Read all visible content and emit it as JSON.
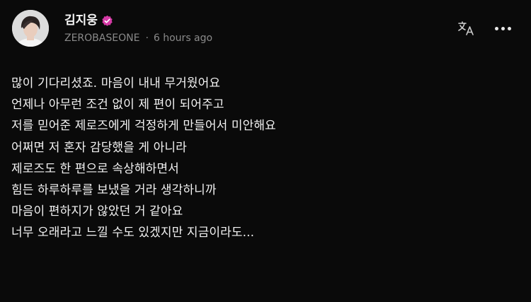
{
  "post": {
    "author_name": "김지웅",
    "group_name": "ZEROBASEONE",
    "separator": "·",
    "timestamp": "6 hours ago",
    "verified": true,
    "lines": [
      "많이 기다리셨죠. 마음이 내내 무거웠어요",
      "언제나 아무런 조건 없이 제 편이 되어주고",
      "저를 믿어준 제로즈에게 걱정하게 만들어서 미안해요",
      "어쩌면 저 혼자 감당했을 게 아니라",
      "제로즈도 한 편으로 속상해하면서",
      "힘든 하루하루를 보냈을 거라 생각하니까",
      "마음이 편하지가 않았던 거 같아요",
      "너무 오래라고 느낄 수도 있겠지만 지금이라도..."
    ]
  },
  "actions": {
    "translate_icon": "translate-icon",
    "more_icon": "more-horizontal-icon"
  },
  "colors": {
    "background": "#0a0a0a",
    "text": "#f3f3f3",
    "meta": "#8a8a8a",
    "badge": "#d63aa6"
  }
}
